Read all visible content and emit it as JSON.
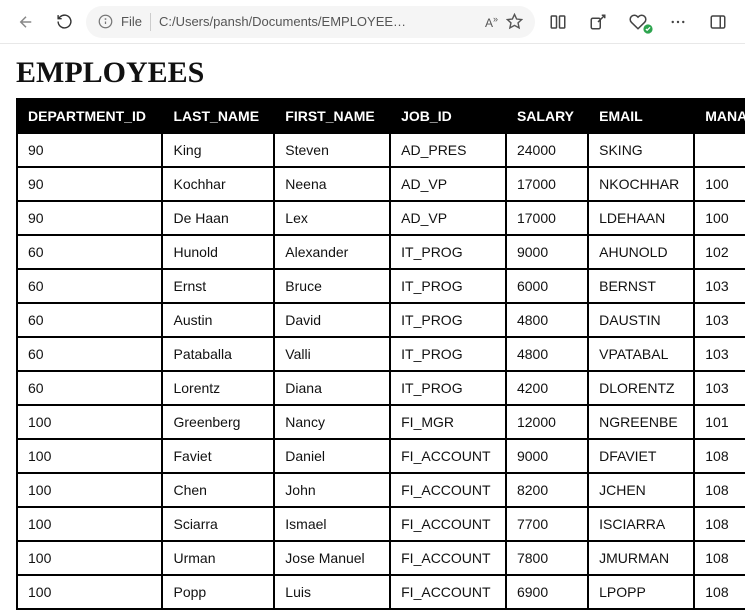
{
  "toolbar": {
    "url_prefix": "File",
    "url": "C:/Users/pansh/Documents/EMPLOYEE…",
    "read_aloud": "A"
  },
  "page": {
    "title": "EMPLOYEES"
  },
  "table": {
    "columns": [
      "DEPARTMENT_ID",
      "LAST_NAME",
      "FIRST_NAME",
      "JOB_ID",
      "SALARY",
      "EMAIL",
      "MANAGER_ID"
    ],
    "rows": [
      {
        "department_id": "90",
        "last_name": "King",
        "first_name": "Steven",
        "job_id": "AD_PRES",
        "salary": "24000",
        "email": "SKING",
        "manager_id": ""
      },
      {
        "department_id": "90",
        "last_name": "Kochhar",
        "first_name": "Neena",
        "job_id": "AD_VP",
        "salary": "17000",
        "email": "NKOCHHAR",
        "manager_id": "100"
      },
      {
        "department_id": "90",
        "last_name": "De Haan",
        "first_name": "Lex",
        "job_id": "AD_VP",
        "salary": "17000",
        "email": "LDEHAAN",
        "manager_id": "100"
      },
      {
        "department_id": "60",
        "last_name": "Hunold",
        "first_name": "Alexander",
        "job_id": "IT_PROG",
        "salary": "9000",
        "email": "AHUNOLD",
        "manager_id": "102"
      },
      {
        "department_id": "60",
        "last_name": "Ernst",
        "first_name": "Bruce",
        "job_id": "IT_PROG",
        "salary": "6000",
        "email": "BERNST",
        "manager_id": "103"
      },
      {
        "department_id": "60",
        "last_name": "Austin",
        "first_name": "David",
        "job_id": "IT_PROG",
        "salary": "4800",
        "email": "DAUSTIN",
        "manager_id": "103"
      },
      {
        "department_id": "60",
        "last_name": "Pataballa",
        "first_name": "Valli",
        "job_id": "IT_PROG",
        "salary": "4800",
        "email": "VPATABAL",
        "manager_id": "103"
      },
      {
        "department_id": "60",
        "last_name": "Lorentz",
        "first_name": "Diana",
        "job_id": "IT_PROG",
        "salary": "4200",
        "email": "DLORENTZ",
        "manager_id": "103"
      },
      {
        "department_id": "100",
        "last_name": "Greenberg",
        "first_name": "Nancy",
        "job_id": "FI_MGR",
        "salary": "12000",
        "email": "NGREENBE",
        "manager_id": "101"
      },
      {
        "department_id": "100",
        "last_name": "Faviet",
        "first_name": "Daniel",
        "job_id": "FI_ACCOUNT",
        "salary": "9000",
        "email": "DFAVIET",
        "manager_id": "108"
      },
      {
        "department_id": "100",
        "last_name": "Chen",
        "first_name": "John",
        "job_id": "FI_ACCOUNT",
        "salary": "8200",
        "email": "JCHEN",
        "manager_id": "108"
      },
      {
        "department_id": "100",
        "last_name": "Sciarra",
        "first_name": "Ismael",
        "job_id": "FI_ACCOUNT",
        "salary": "7700",
        "email": "ISCIARRA",
        "manager_id": "108"
      },
      {
        "department_id": "100",
        "last_name": "Urman",
        "first_name": "Jose Manuel",
        "job_id": "FI_ACCOUNT",
        "salary": "7800",
        "email": "JMURMAN",
        "manager_id": "108"
      },
      {
        "department_id": "100",
        "last_name": "Popp",
        "first_name": "Luis",
        "job_id": "FI_ACCOUNT",
        "salary": "6900",
        "email": "LPOPP",
        "manager_id": "108"
      }
    ]
  }
}
